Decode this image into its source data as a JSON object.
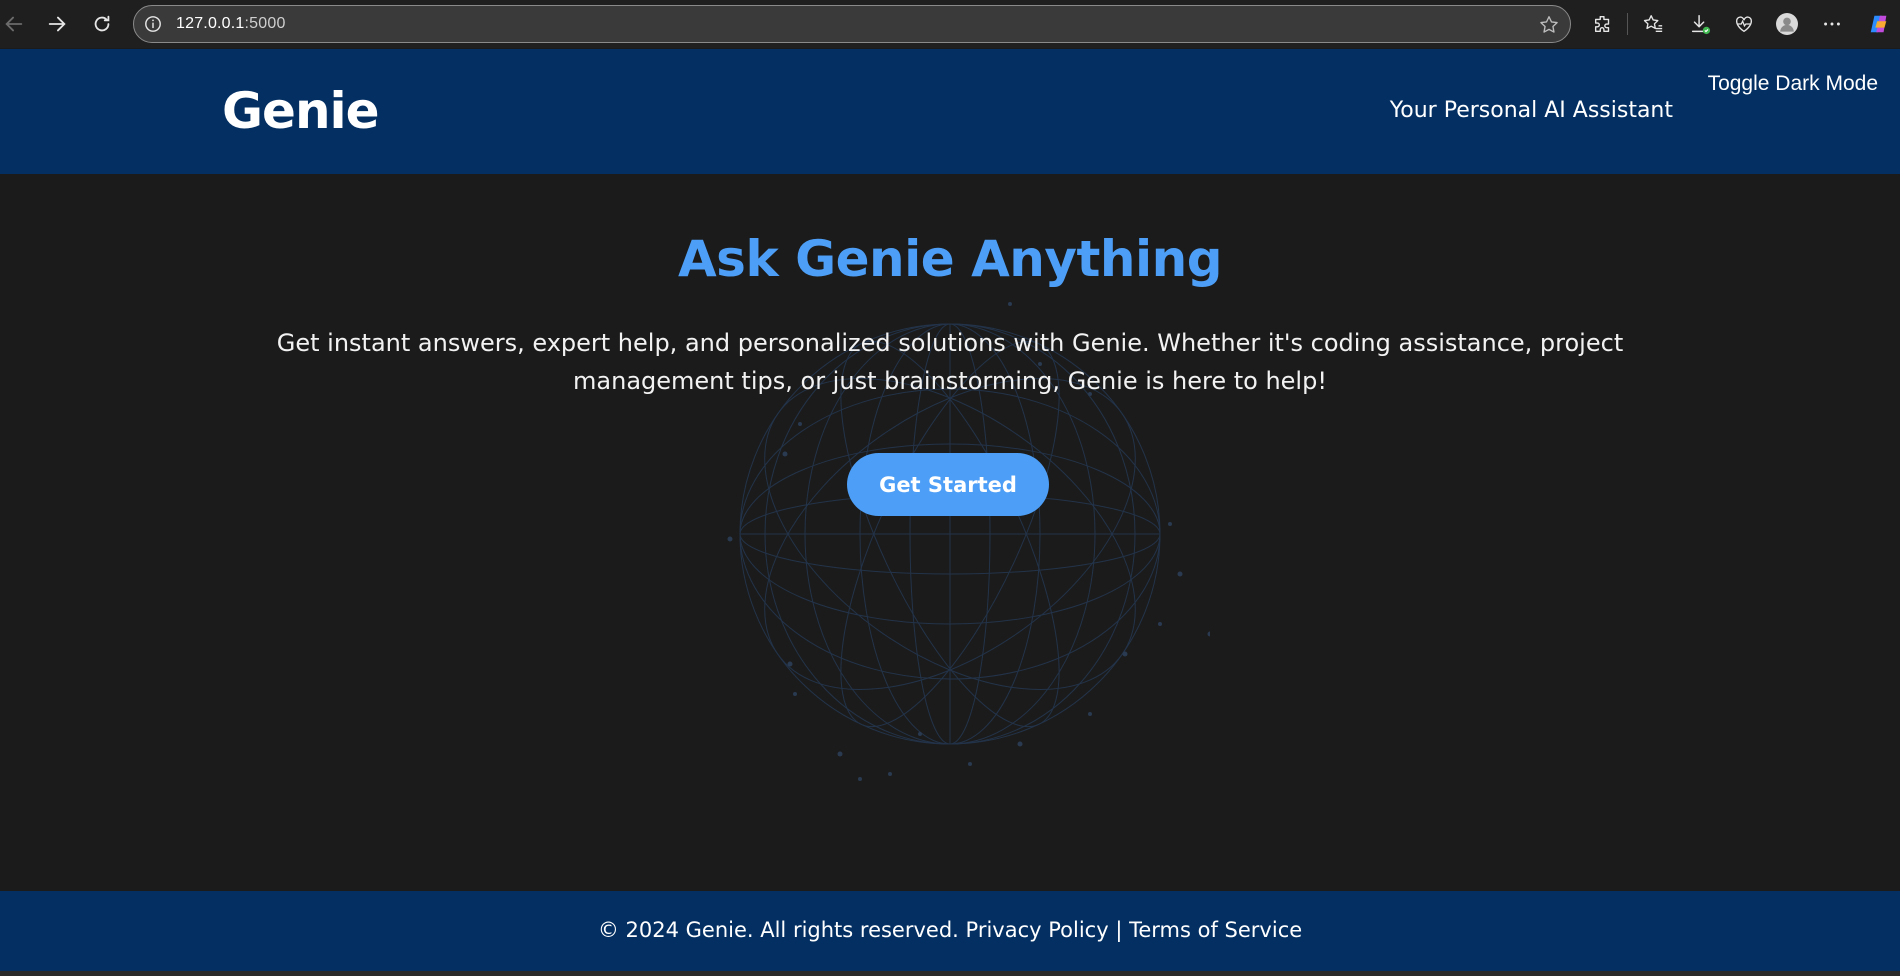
{
  "browser": {
    "url_host": "127.0.0.1",
    "url_port": ":5000"
  },
  "icons": {
    "back": "back-arrow-icon",
    "forward": "forward-arrow-icon",
    "reload": "reload-icon",
    "info": "info-icon",
    "favorite": "star-icon",
    "extensions": "puzzle-icon",
    "favorites": "favorites-icon",
    "downloads": "download-icon",
    "health": "heart-pulse-icon",
    "profile": "avatar-icon",
    "more": "more-icon",
    "copilot": "copilot-icon"
  },
  "header": {
    "logo": "Genie",
    "tagline": "Your Personal AI Assistant",
    "toggle_label": "Toggle Dark Mode"
  },
  "hero": {
    "title": "Ask Genie Anything",
    "description": "Get instant answers, expert help, and personalized solutions with Genie. Whether it's coding assistance, project management tips, or just brainstorming, Genie is here to help!",
    "cta_label": "Get Started"
  },
  "footer": {
    "copyright": "© 2024 Genie. All rights reserved.",
    "privacy_link": "Privacy Policy",
    "separator": "|",
    "terms_link": "Terms of Service"
  },
  "colors": {
    "header_bg": "#032f62",
    "page_bg": "#1b1b1b",
    "accent": "#4d9ef6",
    "chrome_bg": "#1f1f1f"
  }
}
